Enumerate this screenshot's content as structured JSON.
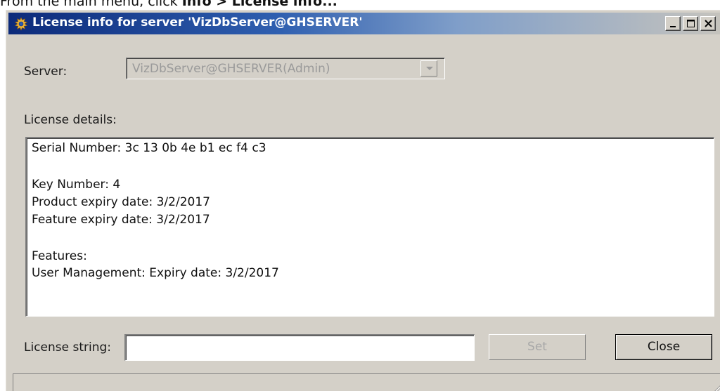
{
  "caption": {
    "prefix": "From the main menu, click ",
    "bold": "Info > License info..."
  },
  "window": {
    "title": "License info for server 'VizDbServer@GHSERVER'",
    "icon": "gear-icon",
    "controls": [
      "minimize-icon",
      "maximize-icon",
      "close-icon"
    ]
  },
  "server": {
    "label": "Server:",
    "value": "VizDbServer@GHSERVER(Admin)"
  },
  "details": {
    "label": "License details:",
    "lines": [
      "Serial Number: 3c 13 0b 4e b1 ec f4 c3",
      "",
      "Key Number: 4",
      "Product expiry date: 3/2/2017",
      "Feature expiry date: 3/2/2017",
      "",
      "Features:",
      "User Management: Expiry date: 3/2/2017"
    ]
  },
  "license": {
    "label": "License string:",
    "value": ""
  },
  "buttons": {
    "set": "Set",
    "close": "Close"
  },
  "colors": {
    "window_face": "#d4d0c8",
    "title_start": "#0c2a7a",
    "title_end": "#c5c3bd",
    "disabled_text": "#9a9a9a"
  }
}
